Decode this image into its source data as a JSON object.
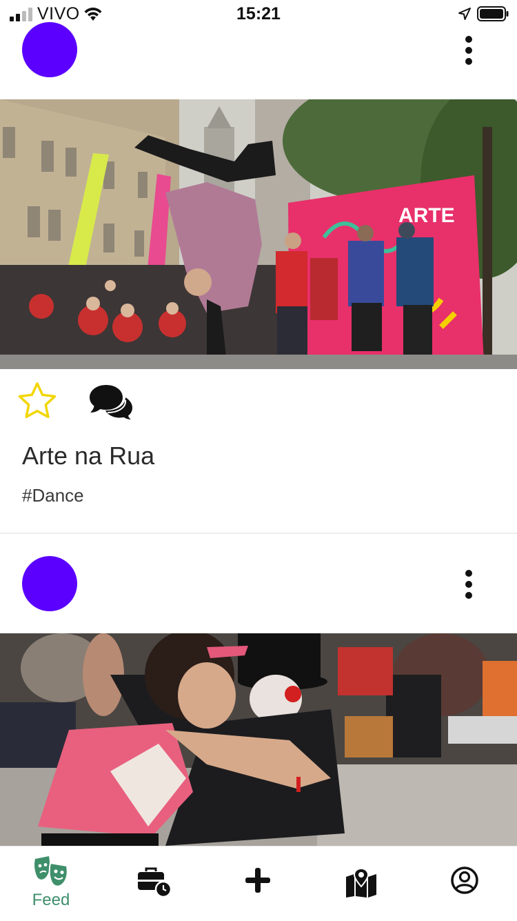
{
  "status_bar": {
    "carrier": "VIVO",
    "time": "15:21"
  },
  "posts": [
    {
      "title": "Arte na Rua",
      "tag": "#Dance",
      "photo_description_icon": "street-dance-photo",
      "favorite_icon": "star-outline-icon",
      "comments_icon": "comments-icon"
    },
    {
      "photo_description_icon": "street-clown-photo"
    }
  ],
  "bottom_nav": {
    "items": [
      {
        "label": "Feed",
        "icon": "theater-masks-icon",
        "active": true
      },
      {
        "label": "",
        "icon": "briefcase-clock-icon"
      },
      {
        "label": "",
        "icon": "plus-icon"
      },
      {
        "label": "",
        "icon": "map-marker-icon"
      },
      {
        "label": "",
        "icon": "user-circle-icon"
      }
    ]
  },
  "colors": {
    "avatar": "#5b00ff",
    "active_nav": "#3f8f6b",
    "star": "#f2d600",
    "banner_pink": "#e8306a"
  }
}
